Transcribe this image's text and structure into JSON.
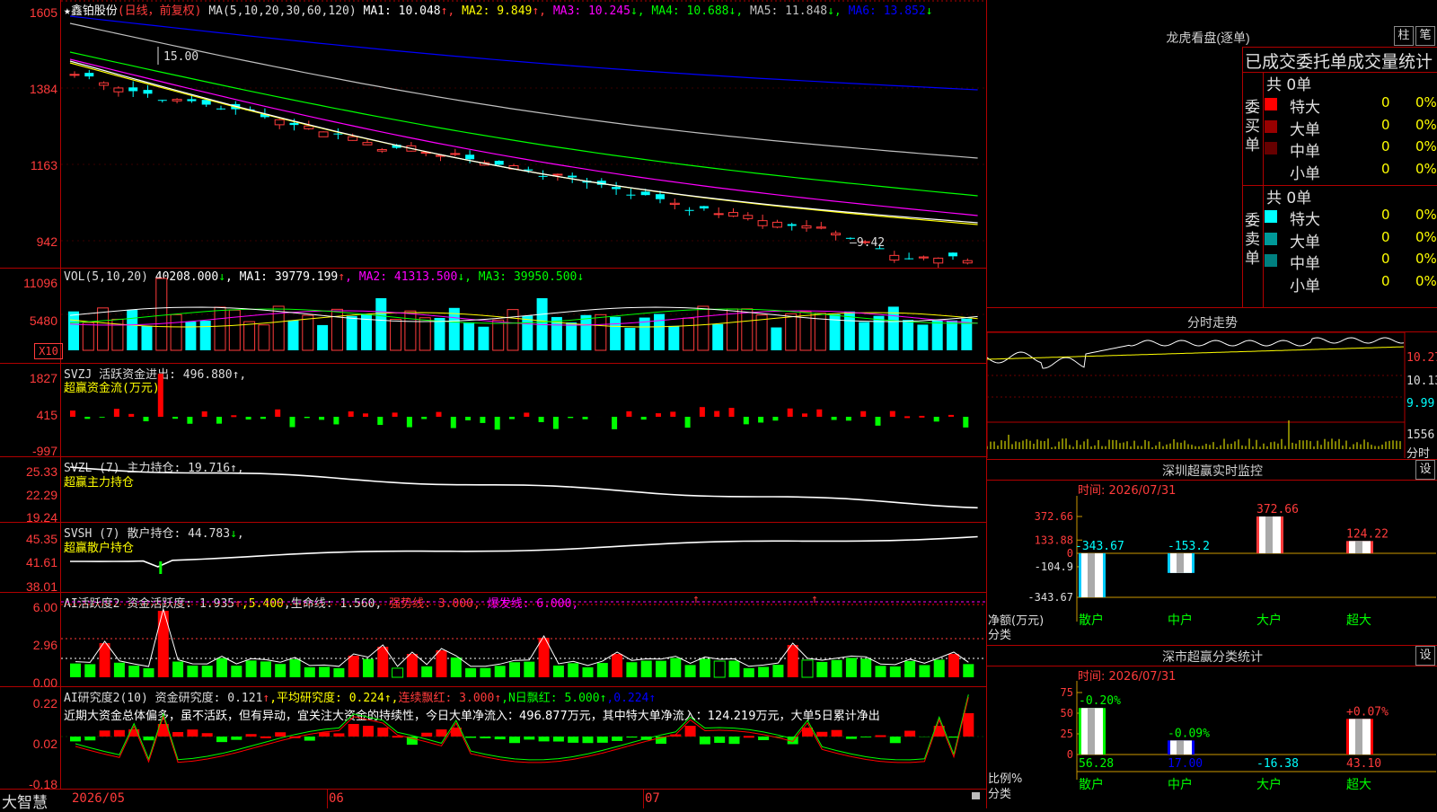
{
  "app": {
    "brand": "大智慧"
  },
  "kline": {
    "name": "★鑫铂股份",
    "period": "(日线，前复权)",
    "ma_label": "MA(5,10,20,30,60,120)",
    "ma": [
      {
        "label": "MA1: 10.048",
        "arrow": "↑",
        "color": "#ffffff"
      },
      {
        "label": "MA2: 9.849",
        "arrow": "↑",
        "color": "#ffff00"
      },
      {
        "label": "MA3: 10.245",
        "arrow": "↓",
        "color": "#ff00ff"
      },
      {
        "label": "MA4: 10.688",
        "arrow": "↓",
        "color": "#00ff00"
      },
      {
        "label": "MA5: 11.848",
        "arrow": "↓",
        "color": "#c0c0c0"
      },
      {
        "label": "MA6: 13.852",
        "arrow": "↓",
        "color": "#0000ff"
      }
    ],
    "y_ticks": [
      "1605",
      "1384",
      "1163",
      "942"
    ],
    "high_label": "15.00",
    "low_label": "9.42"
  },
  "vol": {
    "label": "VOL(5,10,20)",
    "value": "40208.000",
    "ma": [
      {
        "label": "MA1: 39779.199",
        "arrow": "↑",
        "color": "#ffffff"
      },
      {
        "label": "MA2: 41313.500",
        "arrow": "↓",
        "color": "#ff00ff"
      },
      {
        "label": "MA3: 39950.500",
        "arrow": "↓",
        "color": "#00ff00"
      }
    ],
    "y_ticks": [
      "11096",
      "5480"
    ],
    "unit": "X10"
  },
  "svzj": {
    "label": "SVZJ  活跃资金进出: 496.880↑,",
    "sub": "超赢资金流(万元)",
    "y_ticks": [
      "1827",
      "415",
      "-997"
    ]
  },
  "svzl": {
    "label": "SVZL (7) 主力持仓: 19.716↑,",
    "sub": "超赢主力持仓",
    "y_ticks": [
      "25.33",
      "22.29",
      "19.24"
    ]
  },
  "svsh": {
    "label": "SVSH (7) 散户持仓: 44.783",
    "arrow": "↓",
    "trail": ",",
    "sub": "超赢散户持仓",
    "y_ticks": [
      "45.35",
      "41.61",
      "38.01"
    ]
  },
  "ai_active": {
    "prefix": "AI活跃度2 资金活跃度: 1.935",
    "a1": "↑",
    "v2": ",5.400",
    "v3": ",生命线: 1.560,",
    "strong": "强势线: 3.000,",
    "burst": "爆发线: 6.000,",
    "y_ticks": [
      "6.00",
      "2.96",
      "0.00"
    ]
  },
  "ai_research": {
    "prefix": "AI研究度2(10) 资金研究度: 0.121",
    "a1": "↑",
    "avg": ",平均研究度: 0.224↑,",
    "lianxu": "连续飘红: 3.000",
    "a2": "↑",
    "nri": ",N日飘红: 5.000",
    "a3": "↑",
    "last": ",0.224↑",
    "comment": "近期大资金总体偏多，虽不活跃，但有异动，宜关注大资金的持续性，今日大单净流入：496.877万元，其中特大单净流入：124.219万元，大单5日累计净出",
    "y_ticks": [
      "0.22",
      "0.02",
      "-0.18"
    ]
  },
  "dates": [
    "2026/05",
    "06",
    "07"
  ],
  "lhb": {
    "title": "龙虎看盘(逐单)",
    "btn1": "柱",
    "btn2": "笔",
    "header": "已成交委托单成交量统计",
    "buy_label": [
      "委",
      "买",
      "单"
    ],
    "sell_label": [
      "委",
      "卖",
      "单"
    ],
    "buy_total": "共 0单",
    "sell_total": "共 0单",
    "buy_rows": [
      {
        "name": "特大",
        "n": "0",
        "p": "0%",
        "color": "#ff0000"
      },
      {
        "name": "大单",
        "n": "0",
        "p": "0%",
        "color": "#990000"
      },
      {
        "name": "中单",
        "n": "0",
        "p": "0%",
        "color": "#660000"
      },
      {
        "name": "小单",
        "n": "0",
        "p": "0%",
        "color": "#000000"
      }
    ],
    "sell_rows": [
      {
        "name": "特大",
        "n": "0",
        "p": "0%",
        "color": "#00ffff"
      },
      {
        "name": "大单",
        "n": "0",
        "p": "0%",
        "color": "#009999"
      },
      {
        "name": "中单",
        "n": "0",
        "p": "0%",
        "color": "#008080"
      },
      {
        "name": "小单",
        "n": "0",
        "p": "0%",
        "color": "#000000"
      }
    ]
  },
  "fenshi": {
    "title": "分时走势",
    "y_ticks": [
      "10.27",
      "10.13",
      "9.99"
    ],
    "vol_tick": "1556",
    "unit": "分时"
  },
  "monitor": {
    "title": "深圳超赢实时监控",
    "btn": "设",
    "time": "时间: 2026/07/31",
    "y_ticks": [
      "372.66",
      "133.88",
      "0",
      "-104.9",
      "-343.67"
    ],
    "ylabel1": "净额(万元)",
    "ylabel2": "分类",
    "categories": [
      "散户",
      "中户",
      "大户",
      "超大"
    ],
    "values": [
      -343.67,
      -153.2,
      372.66,
      124.22
    ],
    "value_labels": [
      "-343.67",
      "-153.2",
      "372.66",
      "124.22"
    ]
  },
  "classify": {
    "title": "深市超赢分类统计",
    "btn": "设",
    "time": "时间: 2026/07/31",
    "y_ticks": [
      "75",
      "50",
      "25",
      "0"
    ],
    "ylabel1": "比例%",
    "ylabel2": "分类",
    "categories": [
      "散户",
      "中户",
      "大户",
      "超大"
    ],
    "bar_values": [
      56.28,
      17.0,
      0,
      43.1
    ],
    "pct_labels": [
      "-0.20%",
      "-0.09%",
      "",
      "+0.07%"
    ],
    "bottom_labels": [
      "56.28",
      "17.00",
      "-16.38",
      "43.10"
    ]
  },
  "chart_data": [
    {
      "type": "line",
      "name": "kline",
      "y_ticks": [
        1605,
        1384,
        1163,
        942
      ]
    },
    {
      "type": "bar",
      "name": "monitor",
      "categories": [
        "散户",
        "中户",
        "大户",
        "超大"
      ],
      "values": [
        -343.67,
        -153.2,
        372.66,
        124.22
      ],
      "ylim": [
        -343.67,
        372.66
      ]
    },
    {
      "type": "bar",
      "name": "classify",
      "categories": [
        "散户",
        "中户",
        "大户",
        "超大"
      ],
      "values": [
        56.28,
        17.0,
        -16.38,
        43.1
      ],
      "ylim": [
        0,
        75
      ]
    }
  ]
}
